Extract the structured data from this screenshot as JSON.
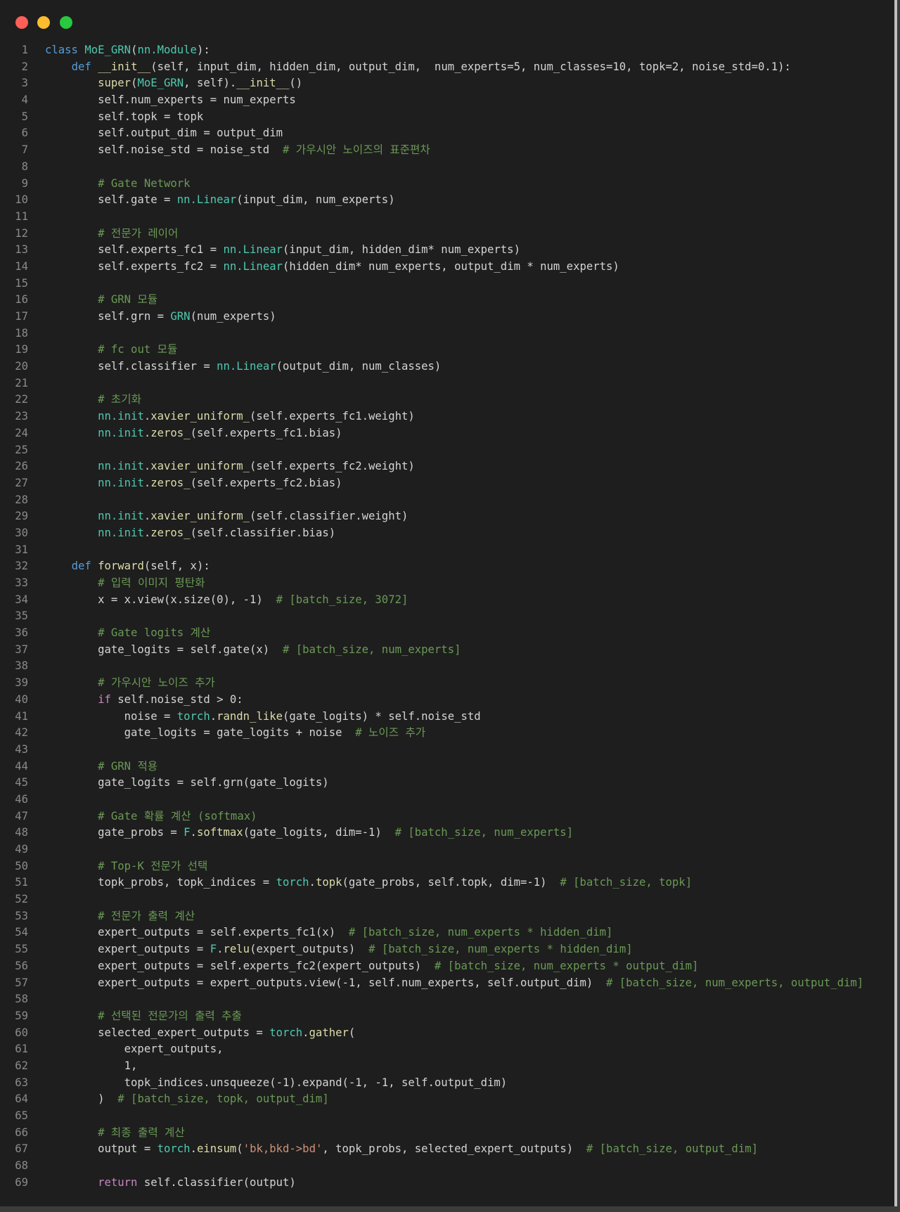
{
  "window": {
    "controls": [
      "close",
      "minimize",
      "zoom"
    ]
  },
  "code": {
    "language": "python",
    "lines": [
      [
        [
          "kw",
          "class"
        ],
        [
          "pl",
          " "
        ],
        [
          "cls",
          "MoE_GRN"
        ],
        [
          "pl",
          "("
        ],
        [
          "cls",
          "nn.Module"
        ],
        [
          "pl",
          "):"
        ]
      ],
      [
        [
          "pl",
          "    "
        ],
        [
          "kw",
          "def"
        ],
        [
          "pl",
          " "
        ],
        [
          "fn",
          "__init__"
        ],
        [
          "pl",
          "(self, input_dim, hidden_dim, output_dim,  num_experts=5, num_classes=10, topk=2, noise_std=0.1):"
        ]
      ],
      [
        [
          "pl",
          "        "
        ],
        [
          "fn",
          "super"
        ],
        [
          "pl",
          "("
        ],
        [
          "cls",
          "MoE_GRN"
        ],
        [
          "pl",
          ", self)."
        ],
        [
          "fn",
          "__init__"
        ],
        [
          "pl",
          "()"
        ]
      ],
      [
        [
          "pl",
          "        self.num_experts = num_experts"
        ]
      ],
      [
        [
          "pl",
          "        self.topk = topk"
        ]
      ],
      [
        [
          "pl",
          "        self.output_dim = output_dim"
        ]
      ],
      [
        [
          "pl",
          "        self.noise_std = noise_std  "
        ],
        [
          "cm",
          "# 가우시안 노이즈의 표준편차"
        ]
      ],
      [],
      [
        [
          "pl",
          "        "
        ],
        [
          "cm",
          "# Gate Network"
        ]
      ],
      [
        [
          "pl",
          "        self.gate = "
        ],
        [
          "cls",
          "nn.Linear"
        ],
        [
          "pl",
          "(input_dim, num_experts)"
        ]
      ],
      [],
      [
        [
          "pl",
          "        "
        ],
        [
          "cm",
          "# 전문가 레이어"
        ]
      ],
      [
        [
          "pl",
          "        self.experts_fc1 = "
        ],
        [
          "cls",
          "nn.Linear"
        ],
        [
          "pl",
          "(input_dim, hidden_dim* num_experts)"
        ]
      ],
      [
        [
          "pl",
          "        self.experts_fc2 = "
        ],
        [
          "cls",
          "nn.Linear"
        ],
        [
          "pl",
          "(hidden_dim* num_experts, output_dim * num_experts)"
        ]
      ],
      [],
      [
        [
          "pl",
          "        "
        ],
        [
          "cm",
          "# GRN 모듈"
        ]
      ],
      [
        [
          "pl",
          "        self.grn = "
        ],
        [
          "cls",
          "GRN"
        ],
        [
          "pl",
          "(num_experts)"
        ]
      ],
      [],
      [
        [
          "pl",
          "        "
        ],
        [
          "cm",
          "# fc out 모듈"
        ]
      ],
      [
        [
          "pl",
          "        self.classifier = "
        ],
        [
          "cls",
          "nn.Linear"
        ],
        [
          "pl",
          "(output_dim, num_classes)"
        ]
      ],
      [],
      [
        [
          "pl",
          "        "
        ],
        [
          "cm",
          "# 초기화"
        ]
      ],
      [
        [
          "pl",
          "        "
        ],
        [
          "cls",
          "nn.init"
        ],
        [
          "pl",
          "."
        ],
        [
          "fn",
          "xavier_uniform_"
        ],
        [
          "pl",
          "(self.experts_fc1.weight)"
        ]
      ],
      [
        [
          "pl",
          "        "
        ],
        [
          "cls",
          "nn.init"
        ],
        [
          "pl",
          "."
        ],
        [
          "fn",
          "zeros_"
        ],
        [
          "pl",
          "(self.experts_fc1.bias)"
        ]
      ],
      [],
      [
        [
          "pl",
          "        "
        ],
        [
          "cls",
          "nn.init"
        ],
        [
          "pl",
          "."
        ],
        [
          "fn",
          "xavier_uniform_"
        ],
        [
          "pl",
          "(self.experts_fc2.weight)"
        ]
      ],
      [
        [
          "pl",
          "        "
        ],
        [
          "cls",
          "nn.init"
        ],
        [
          "pl",
          "."
        ],
        [
          "fn",
          "zeros_"
        ],
        [
          "pl",
          "(self.experts_fc2.bias)"
        ]
      ],
      [],
      [
        [
          "pl",
          "        "
        ],
        [
          "cls",
          "nn.init"
        ],
        [
          "pl",
          "."
        ],
        [
          "fn",
          "xavier_uniform_"
        ],
        [
          "pl",
          "(self.classifier.weight)"
        ]
      ],
      [
        [
          "pl",
          "        "
        ],
        [
          "cls",
          "nn.init"
        ],
        [
          "pl",
          "."
        ],
        [
          "fn",
          "zeros_"
        ],
        [
          "pl",
          "(self.classifier.bias)"
        ]
      ],
      [],
      [
        [
          "pl",
          "    "
        ],
        [
          "kw",
          "def"
        ],
        [
          "pl",
          " "
        ],
        [
          "fn",
          "forward"
        ],
        [
          "pl",
          "(self, x):"
        ]
      ],
      [
        [
          "pl",
          "        "
        ],
        [
          "cm",
          "# 입력 이미지 평탄화"
        ]
      ],
      [
        [
          "pl",
          "        x = x.view(x.size(0), -1)  "
        ],
        [
          "cm",
          "# [batch_size, 3072]"
        ]
      ],
      [],
      [
        [
          "pl",
          "        "
        ],
        [
          "cm",
          "# Gate logits 계산"
        ]
      ],
      [
        [
          "pl",
          "        gate_logits = self.gate(x)  "
        ],
        [
          "cm",
          "# [batch_size, num_experts]"
        ]
      ],
      [],
      [
        [
          "pl",
          "        "
        ],
        [
          "cm",
          "# 가우시안 노이즈 추가"
        ]
      ],
      [
        [
          "pl",
          "        "
        ],
        [
          "kw2",
          "if"
        ],
        [
          "pl",
          " self.noise_std > 0:"
        ]
      ],
      [
        [
          "pl",
          "            noise = "
        ],
        [
          "cls",
          "torch"
        ],
        [
          "pl",
          "."
        ],
        [
          "fn",
          "randn_like"
        ],
        [
          "pl",
          "(gate_logits) * self.noise_std"
        ]
      ],
      [
        [
          "pl",
          "            gate_logits = gate_logits + noise  "
        ],
        [
          "cm",
          "# 노이즈 추가"
        ]
      ],
      [],
      [
        [
          "pl",
          "        "
        ],
        [
          "cm",
          "# GRN 적용"
        ]
      ],
      [
        [
          "pl",
          "        gate_logits = self.grn(gate_logits)"
        ]
      ],
      [],
      [
        [
          "pl",
          "        "
        ],
        [
          "cm",
          "# Gate 확률 계산 (softmax)"
        ]
      ],
      [
        [
          "pl",
          "        gate_probs = "
        ],
        [
          "cls",
          "F"
        ],
        [
          "pl",
          "."
        ],
        [
          "fn",
          "softmax"
        ],
        [
          "pl",
          "(gate_logits, dim=-1)  "
        ],
        [
          "cm",
          "# [batch_size, num_experts]"
        ]
      ],
      [],
      [
        [
          "pl",
          "        "
        ],
        [
          "cm",
          "# Top-K 전문가 선택"
        ]
      ],
      [
        [
          "pl",
          "        topk_probs, topk_indices = "
        ],
        [
          "cls",
          "torch"
        ],
        [
          "pl",
          "."
        ],
        [
          "fn",
          "topk"
        ],
        [
          "pl",
          "(gate_probs, self.topk, dim=-1)  "
        ],
        [
          "cm",
          "# [batch_size, topk]"
        ]
      ],
      [],
      [
        [
          "pl",
          "        "
        ],
        [
          "cm",
          "# 전문가 출력 계산"
        ]
      ],
      [
        [
          "pl",
          "        expert_outputs = self.experts_fc1(x)  "
        ],
        [
          "cm",
          "# [batch_size, num_experts * hidden_dim]"
        ]
      ],
      [
        [
          "pl",
          "        expert_outputs = "
        ],
        [
          "cls",
          "F"
        ],
        [
          "pl",
          "."
        ],
        [
          "fn",
          "relu"
        ],
        [
          "pl",
          "(expert_outputs)  "
        ],
        [
          "cm",
          "# [batch_size, num_experts * hidden_dim]"
        ]
      ],
      [
        [
          "pl",
          "        expert_outputs = self.experts_fc2(expert_outputs)  "
        ],
        [
          "cm",
          "# [batch_size, num_experts * output_dim]"
        ]
      ],
      [
        [
          "pl",
          "        expert_outputs = expert_outputs.view(-1, self.num_experts, self.output_dim)  "
        ],
        [
          "cm",
          "# [batch_size, num_experts, output_dim]"
        ]
      ],
      [],
      [
        [
          "pl",
          "        "
        ],
        [
          "cm",
          "# 선택된 전문가의 출력 추출"
        ]
      ],
      [
        [
          "pl",
          "        selected_expert_outputs = "
        ],
        [
          "cls",
          "torch"
        ],
        [
          "pl",
          "."
        ],
        [
          "fn",
          "gather"
        ],
        [
          "pl",
          "("
        ]
      ],
      [
        [
          "pl",
          "            expert_outputs,"
        ]
      ],
      [
        [
          "pl",
          "            1,"
        ]
      ],
      [
        [
          "pl",
          "            topk_indices.unsqueeze(-1).expand(-1, -1, self.output_dim)"
        ]
      ],
      [
        [
          "pl",
          "        )  "
        ],
        [
          "cm",
          "# [batch_size, topk, output_dim]"
        ]
      ],
      [],
      [
        [
          "pl",
          "        "
        ],
        [
          "cm",
          "# 최종 출력 계산"
        ]
      ],
      [
        [
          "pl",
          "        output = "
        ],
        [
          "cls",
          "torch"
        ],
        [
          "pl",
          "."
        ],
        [
          "fn",
          "einsum"
        ],
        [
          "pl",
          "("
        ],
        [
          "str",
          "'bk,bkd->bd'"
        ],
        [
          "pl",
          ", topk_probs, selected_expert_outputs)  "
        ],
        [
          "cm",
          "# [batch_size, output_dim]"
        ]
      ],
      [],
      [
        [
          "pl",
          "        "
        ],
        [
          "kw2",
          "return"
        ],
        [
          "pl",
          " self.classifier(output)"
        ]
      ]
    ]
  }
}
